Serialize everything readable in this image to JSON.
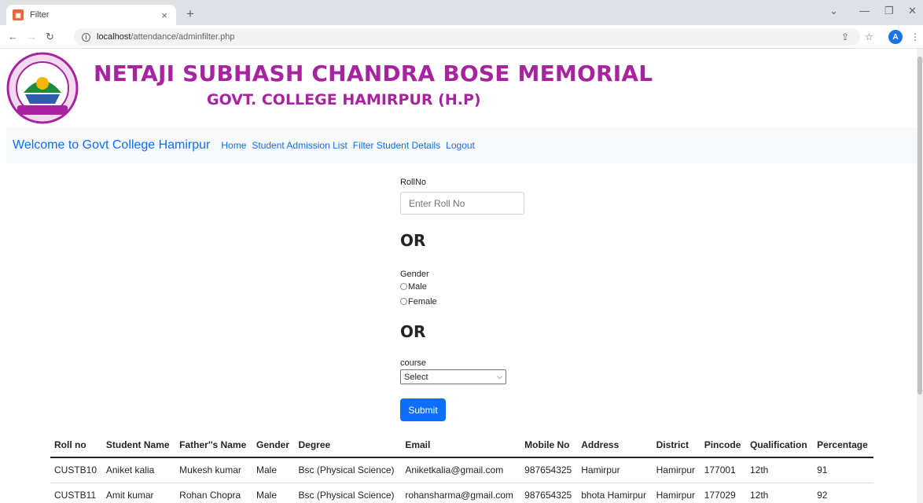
{
  "browser": {
    "tab_title": "Filter",
    "tab_close": "×",
    "new_tab": "+",
    "url_host": "localhost",
    "url_path": "/attendance/adminfilter.php",
    "profile_initial": "A"
  },
  "header": {
    "college_name": "NETAJI SUBHASH CHANDRA BOSE MEMORIAL",
    "college_sub": "GOVT. COLLEGE HAMIRPUR (H.P)"
  },
  "navbar": {
    "brand": "Welcome to Govt College Hamirpur",
    "links": [
      "Home",
      "Student Admission List",
      "Filter Student Details",
      "Logout"
    ]
  },
  "form": {
    "rollno_label": "RollNo",
    "rollno_placeholder": "Enter Roll No",
    "or1": "OR",
    "gender_label": "Gender",
    "gender_options": [
      "Male",
      "Female"
    ],
    "or2": "OR",
    "course_label": "course",
    "course_selected": "Select",
    "submit_label": "Submit"
  },
  "table": {
    "columns": [
      "Roll no",
      "Student Name",
      "Father''s Name",
      "Gender",
      "Degree",
      "Email",
      "Mobile No",
      "Address",
      "District",
      "Pincode",
      "Qualification",
      "Percentage"
    ],
    "rows": [
      [
        "CUSTB10",
        "Aniket kalia",
        "Mukesh kumar",
        "Male",
        "Bsc (Physical Science)",
        "Aniketkalia@gmail.com",
        "987654325",
        "Hamirpur",
        "Hamirpur",
        "177001",
        "12th",
        "91"
      ],
      [
        "CUSTB11",
        "Amit kumar",
        "Rohan Chopra",
        "Male",
        "Bsc (Physical Science)",
        "rohansharma@gmail.com",
        "987654325",
        "bhota Hamirpur",
        "Hamirpur",
        "177029",
        "12th",
        "92"
      ]
    ]
  },
  "colors": {
    "brand_purple": "#a8239f",
    "link_blue": "#0d6efd"
  }
}
